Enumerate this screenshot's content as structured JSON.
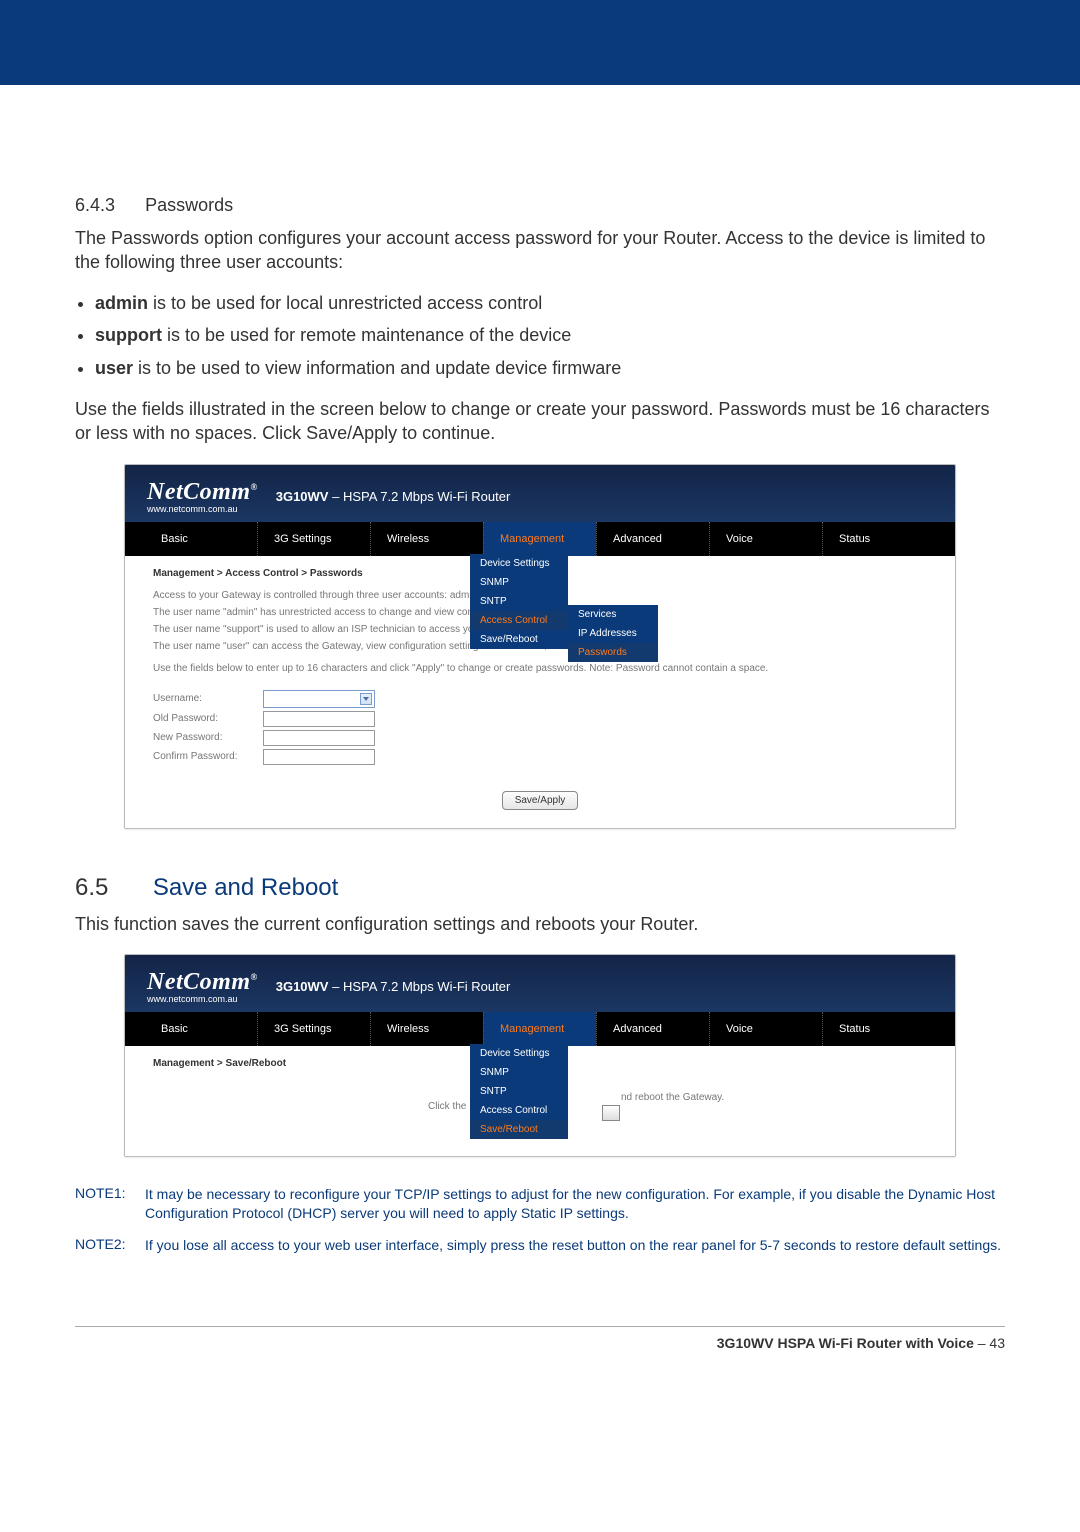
{
  "section1": {
    "num": "6.4.3",
    "title": "Passwords",
    "intro": "The Passwords option configures your account access password for your Router. Access to the device is limited to the following three user accounts:",
    "bullets": [
      {
        "b": "admin",
        "t": " is to be used for local unrestricted access control"
      },
      {
        "b": "support",
        "t": " is to be used for remote maintenance of the device"
      },
      {
        "b": "user",
        "t": " is to be used to view information and update device firmware"
      }
    ],
    "outro": "Use the fields illustrated in the screen below to change or create your password. Passwords must be 16 characters or less with no spaces. Click Save/Apply to continue."
  },
  "shot_common": {
    "logo": "NetComm",
    "logo_sup": "®",
    "logo_sub": "www.netcomm.com.au",
    "model_b": "3G10WV",
    "model_t": " – HSPA 7.2 Mbps Wi-Fi Router",
    "tabs": [
      "Basic",
      "3G Settings",
      "Wireless",
      "Management",
      "Advanced",
      "Voice",
      "Status"
    ]
  },
  "shot1": {
    "crumb": "Management > Access Control > Passwords",
    "lines": [
      "Access to your Gateway is controlled through three user accounts: admin, supp",
      "The user name \"admin\" has unrestricted access to change and view configuratio",
      "The user name \"support\" is used to allow an ISP technician to access your Gate",
      "The user name \"user\" can access the Gateway, view configuration settings and statistics, as well as, update",
      "Use the fields below to enter up to 16 characters and click \"Apply\" to change or create passwords. Note: Password cannot contain a space."
    ],
    "form": [
      "Username:",
      "Old Password:",
      "New Password:",
      "Confirm Password:"
    ],
    "btn": "Save/Apply",
    "menu": [
      "Device Settings",
      "SNMP",
      "SNTP",
      "Access Control",
      "Save/Reboot"
    ],
    "submenu": [
      "Services",
      "IP Addresses",
      "Passwords"
    ]
  },
  "section2": {
    "num": "6.5",
    "title": "Save and Reboot",
    "intro": "This function saves the current configuration settings and reboots your Router."
  },
  "shot2": {
    "crumb": "Management > Save/Reboot",
    "line_pre": "Click the",
    "line_post": "nd reboot the Gateway.",
    "menu": [
      "Device Settings",
      "SNMP",
      "SNTP",
      "Access Control",
      "Save/Reboot"
    ]
  },
  "notes": [
    {
      "l": "NOTE1:",
      "t": "It may be necessary to reconfigure your TCP/IP settings to adjust for the new configuration. For example, if you disable the Dynamic Host Configuration Protocol (DHCP) server you will need to apply Static IP settings."
    },
    {
      "l": "NOTE2:",
      "t": "If you lose all access to your web user interface, simply press the reset button on the rear panel for 5-7 seconds to restore default settings."
    }
  ],
  "footer": {
    "b": "3G10WV HSPA Wi-Fi Router with Voice",
    "t": " – 43"
  }
}
